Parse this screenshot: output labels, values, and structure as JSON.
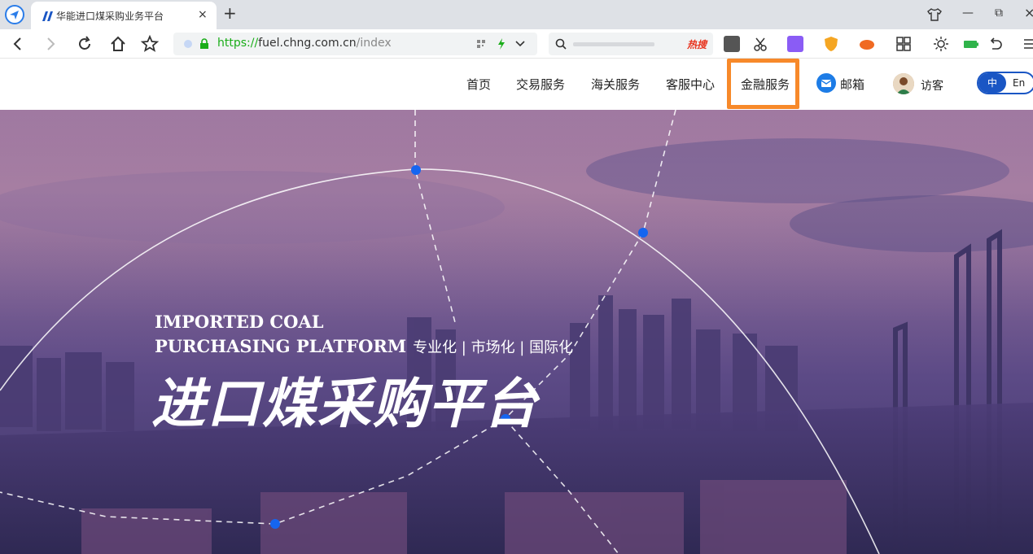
{
  "browser": {
    "tab_title": "华能进口煤采购业务平台",
    "tab_close": "×",
    "new_tab": "+",
    "url_scheme": "https://",
    "url_host": "fuel.chng.com.cn",
    "url_path": "/index",
    "search_hot": "热搜",
    "window_controls": {
      "minimize": "—",
      "restore": "⧉",
      "close": "×"
    }
  },
  "nav": {
    "items": [
      {
        "label": "首页"
      },
      {
        "label": "交易服务"
      },
      {
        "label": "海关服务"
      },
      {
        "label": "客服中心"
      },
      {
        "label": "金融服务"
      }
    ],
    "mail_label": "邮箱",
    "visitor_label": "访客",
    "lang_zh": "中",
    "lang_en": "En"
  },
  "hero": {
    "en_line1": "IMPORTED COAL",
    "en_line2": "PURCHASING PLATFORM",
    "tags": "专业化 | 市场化 | 国际化",
    "cn_title": "进口煤采购平台"
  },
  "colors": {
    "highlight": "#f7892a",
    "brand_blue": "#1a56c4",
    "dot_blue": "#1565f0"
  }
}
